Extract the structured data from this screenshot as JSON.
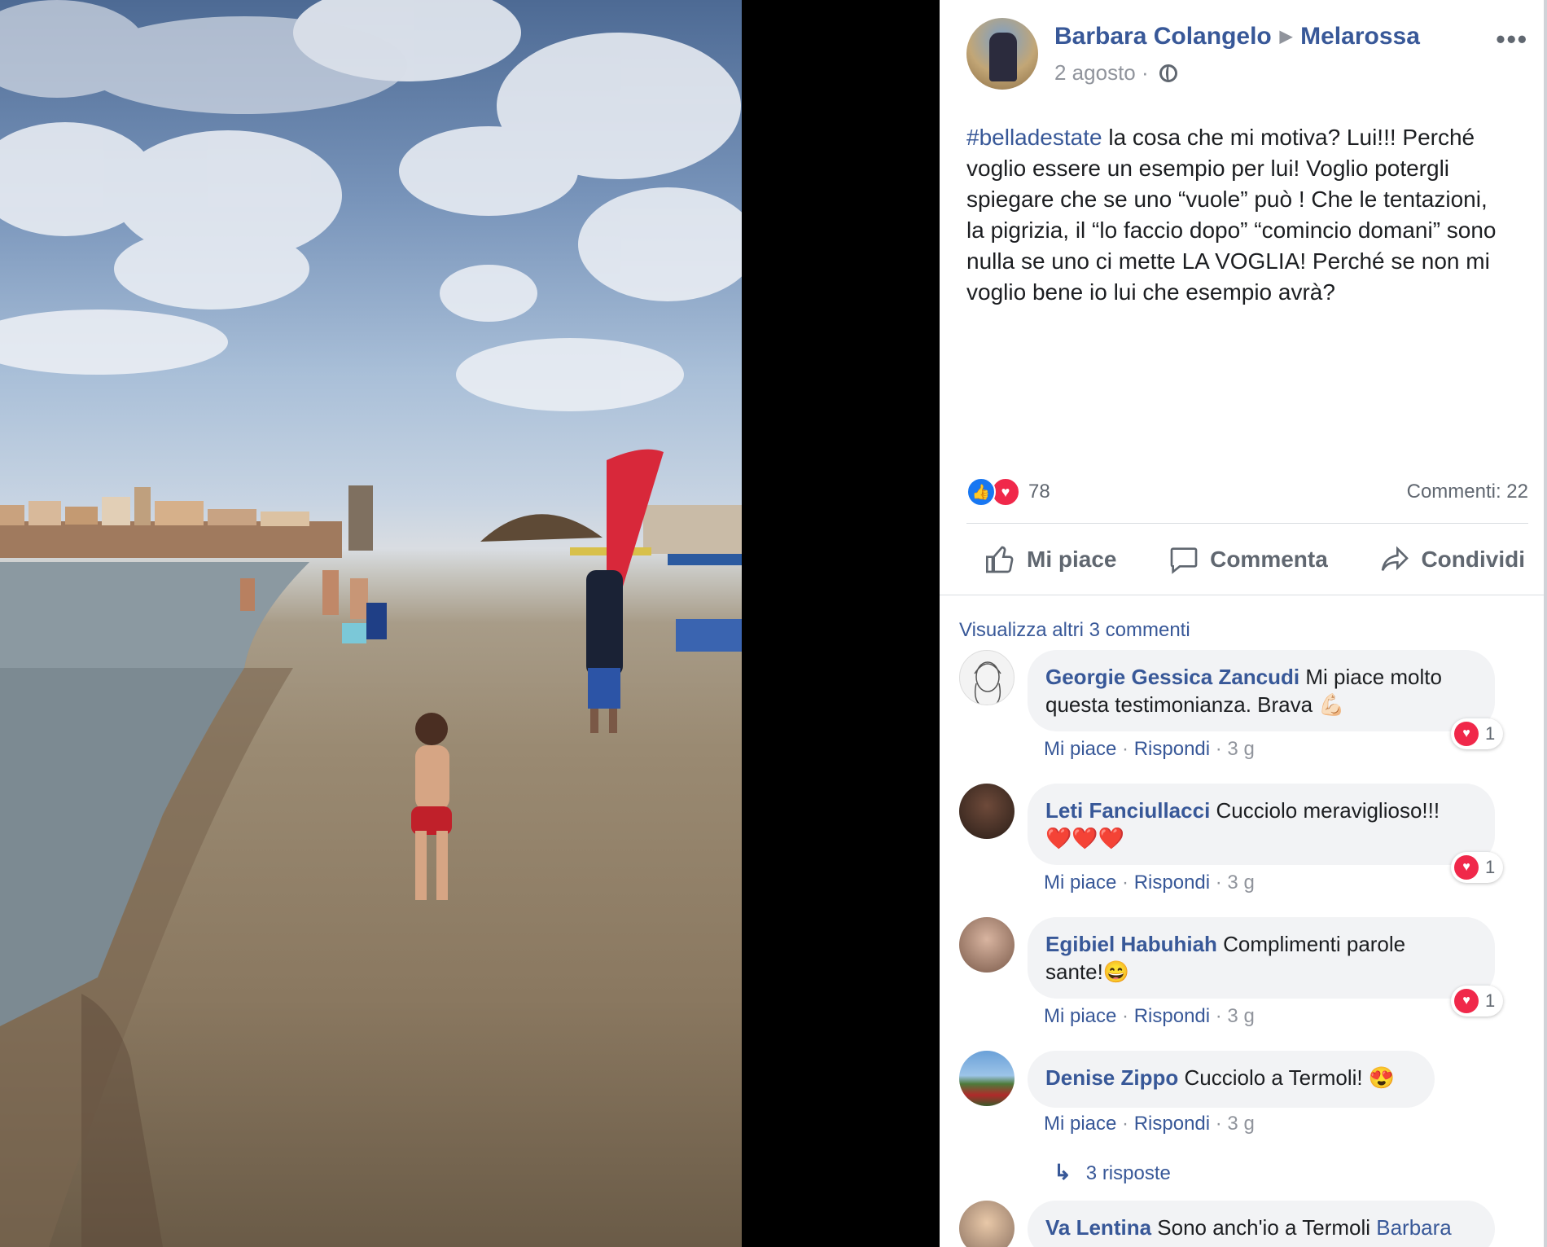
{
  "post": {
    "author": "Barbara Colangelo",
    "page": "Melarossa",
    "date": "2 agosto · ",
    "hashtag": "#belladestate",
    "text": " la cosa che mi motiva? Lui!!! Perché voglio essere un esempio per lui! Voglio potergli spiegare che se uno “vuole” può ! Che le tentazioni, la pigrizia, il “lo faccio dopo” “comincio domani” sono nulla se uno ci mette LA VOGLIA! Perché se non mi voglio bene io lui che esempio avrà?",
    "more_icon": "•••",
    "privacy_icon": "globe-icon"
  },
  "reactions": {
    "count": "78",
    "comments_count": "Commenti: 22",
    "types": [
      "like",
      "love"
    ]
  },
  "actions": {
    "like": "Mi piace",
    "comment": "Commenta",
    "share": "Condividi"
  },
  "view_more": "Visualizza altri 3 commenti",
  "comment_links": {
    "like": "Mi piace",
    "reply": "Rispondi"
  },
  "comments": [
    {
      "name": "Georgie Gessica Zancudi",
      "text": " Mi piace molto",
      "text2": "questa testimonianza. Brava ",
      "emoji": "💪🏻",
      "time": "3 g",
      "reactions": "1"
    },
    {
      "name": "Leti Fanciullacci",
      "text": " Cucciolo meraviglioso!!!",
      "emoji": "❤️❤️❤️",
      "time": "3 g",
      "reactions": "1"
    },
    {
      "name": "Egibiel Habuhiah",
      "text": " Complimenti parole",
      "text2": "sante!",
      "emoji": "😄",
      "time": "3 g",
      "reactions": "1"
    },
    {
      "name": "Denise Zippo",
      "text": " Cucciolo a Termoli! ",
      "emoji": "😍",
      "time": "3 g"
    },
    {
      "name": "Va Lentina",
      "text": " Sono anch'io a Termoli ",
      "mention": "Barbara"
    }
  ],
  "replies": "3 risposte",
  "colors": {
    "link": "#385898",
    "meta": "#90949c",
    "like": "#1877f2",
    "love": "#f0284a",
    "bubble": "#f2f3f5"
  }
}
